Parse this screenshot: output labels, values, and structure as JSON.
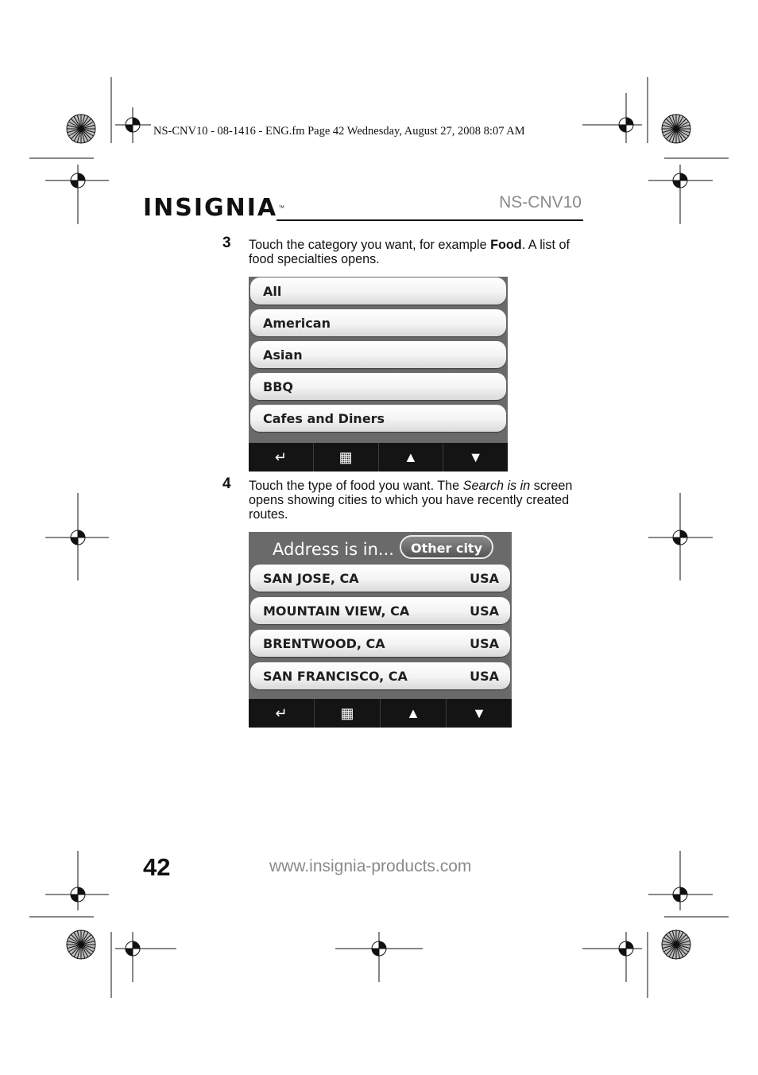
{
  "print_header": "NS-CNV10 - 08-1416 - ENG.fm  Page 42  Wednesday, August 27, 2008  8:07 AM",
  "brand": {
    "name": "INSIGNIA",
    "tm": "™"
  },
  "model": "NS-CNV10",
  "steps": [
    {
      "number": "3",
      "text_before": "Touch the category you want, for example ",
      "bold": "Food",
      "text_after": ". A list of food specialties opens."
    },
    {
      "number": "4",
      "text_before": "Touch the type of food you want. The ",
      "italic": "Search is in",
      "text_after": " screen opens showing cities to which you have recently created routes."
    }
  ],
  "food_screen": {
    "items": [
      "All",
      "American",
      "Asian",
      "BBQ",
      "Cafes and Diners"
    ]
  },
  "address_screen": {
    "title": "Address is in...",
    "other_city_button": "Other city",
    "rows": [
      {
        "city": "SAN JOSE, CA",
        "country": "USA"
      },
      {
        "city": "MOUNTAIN VIEW, CA",
        "country": "USA"
      },
      {
        "city": "BRENTWOOD, CA",
        "country": "USA"
      },
      {
        "city": "SAN FRANCISCO, CA",
        "country": "USA"
      }
    ]
  },
  "toolbar_icons": [
    "back-arrow-icon",
    "menu-grid-icon",
    "scroll-up-icon",
    "scroll-down-icon"
  ],
  "page_number": "42",
  "website": "www.insignia-products.com"
}
